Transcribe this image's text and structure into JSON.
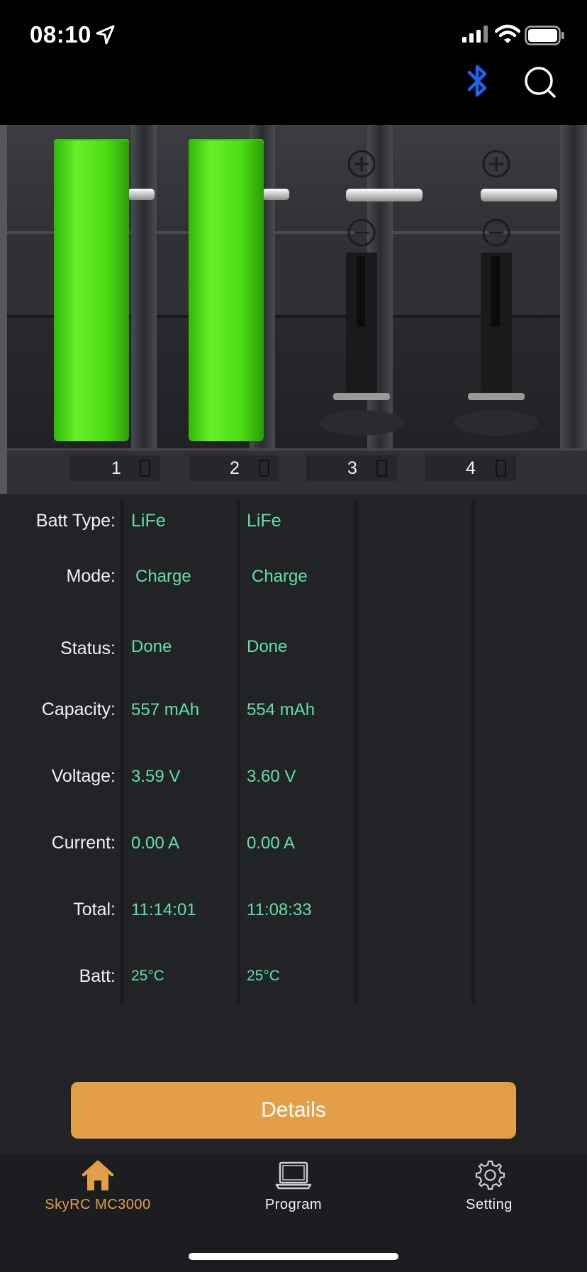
{
  "status_bar": {
    "time": "08:10"
  },
  "slots": [
    {
      "number": "1",
      "occupied": true,
      "batt_type": "LiFe",
      "mode": "Charge",
      "status": "Done",
      "capacity": "557 mAh",
      "voltage": "3.59 V",
      "current": "0.00 A",
      "total": "11:14:01",
      "batt_temp": "25°C"
    },
    {
      "number": "2",
      "occupied": true,
      "batt_type": "LiFe",
      "mode": "Charge",
      "status": "Done",
      "capacity": "554 mAh",
      "voltage": "3.60 V",
      "current": "0.00 A",
      "total": "11:08:33",
      "batt_temp": "25°C"
    },
    {
      "number": "3",
      "occupied": false
    },
    {
      "number": "4",
      "occupied": false
    }
  ],
  "labels": {
    "batt_type": "Batt Type:",
    "mode": "Mode:",
    "status": "Status:",
    "capacity": "Capacity:",
    "voltage": "Voltage:",
    "current": "Current:",
    "total": "Total:",
    "batt": "Batt:"
  },
  "details_button": "Details",
  "tabs": [
    {
      "label": "SkyRC MC3000",
      "icon": "home-icon",
      "active": true
    },
    {
      "label": "Program",
      "icon": "laptop-icon",
      "active": false
    },
    {
      "label": "Setting",
      "icon": "gear-icon",
      "active": false
    }
  ],
  "colors": {
    "accent": "#e39f48",
    "value_text": "#5fe2a6",
    "bluetooth": "#1f64f0",
    "battery_green": "#4ddc14"
  }
}
